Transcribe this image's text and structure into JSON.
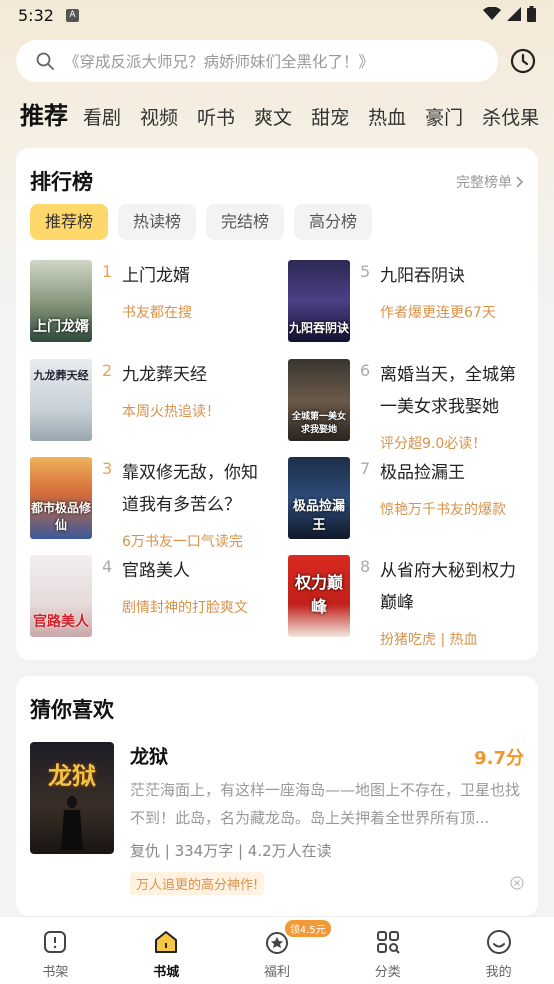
{
  "status": {
    "time": "5:32",
    "indicator": "A"
  },
  "search": {
    "placeholder": "《穿成反派大师兄？病娇师妹们全黑化了！》"
  },
  "tabs": [
    "推荐",
    "看剧",
    "视频",
    "听书",
    "爽文",
    "甜宠",
    "热血",
    "豪门",
    "杀伐果"
  ],
  "ranking": {
    "title": "排行榜",
    "full_list": "完整榜单",
    "chips": [
      "推荐榜",
      "热读榜",
      "完结榜",
      "高分榜"
    ],
    "items": [
      {
        "num": "1",
        "title": "上门龙婿",
        "sub": "书友都在搜",
        "cover_text": "上门龙婿",
        "cover_bg": "linear-gradient(180deg,#cfd6c6 0%,#8b9a7f 50%,#2e4a3a 100%)"
      },
      {
        "num": "2",
        "title": "九龙葬天经",
        "sub": "本周火热追读！",
        "cover_text": "九龙葬天经",
        "cover_bg": "linear-gradient(180deg,#e8ecef 0%,#c9d2d8 60%,#9aa7b0 100%)"
      },
      {
        "num": "3",
        "title": "靠双修无敌，你知道我有多苦么？",
        "sub": "6万书友一口气读完",
        "cover_text": "都市极品修仙",
        "cover_bg": "linear-gradient(180deg,#f0b35a 0%,#d46a3a 45%,#3a5a9a 100%)"
      },
      {
        "num": "4",
        "title": "官路美人",
        "sub": "剧情封神的打脸爽文",
        "cover_text": "官路美人",
        "cover_bg": "linear-gradient(180deg,#f3eeee 0%,#e6dada 60%,#c9a8a8 100%)"
      },
      {
        "num": "5",
        "title": "九阳吞阴诀",
        "sub": "作者爆更连更67天",
        "cover_text": "九阳吞阴诀",
        "cover_bg": "linear-gradient(180deg,#2c2a55 0%,#4b3f86 50%,#141230 100%)"
      },
      {
        "num": "6",
        "title": "离婚当天，全城第一美女求我娶她",
        "sub": "评分超9.0必读！",
        "cover_text": "全城第一美女求我娶她",
        "cover_bg": "linear-gradient(180deg,#3a3530 0%,#6a5a48 50%,#2a2420 100%)"
      },
      {
        "num": "7",
        "title": "极品捡漏王",
        "sub": "惊艳万千书友的爆款",
        "cover_text": "极品捡漏王",
        "cover_bg": "linear-gradient(180deg,#1e2e48 0%,#2d4c7a 50%,#111a2a 100%)"
      },
      {
        "num": "8",
        "title": "从省府大秘到权力巅峰",
        "sub": "扮猪吃虎 | 热血",
        "cover_text": "权力巅峰",
        "cover_bg": "linear-gradient(180deg,#d92a20 0%,#c2201a 60%,#f1e9e0 100%)"
      }
    ]
  },
  "guess": {
    "title": "猜你喜欢",
    "book": {
      "title": "龙狱",
      "score": "9.7分",
      "cover_text": "龙狱",
      "desc": "茫茫海面上，有这样一座海岛——地图上不存在，卫星也找不到！此岛，名为藏龙岛。岛上关押着全世界所有顶...",
      "meta": "复仇 | 334万字 | 4.2万人在读",
      "tag": "万人追更的高分神作!"
    }
  },
  "nav": {
    "items": [
      {
        "label": "书架",
        "icon": "bookshelf-icon"
      },
      {
        "label": "书城",
        "icon": "bookstore-icon"
      },
      {
        "label": "福利",
        "icon": "welfare-icon",
        "badge": "领4.5元"
      },
      {
        "label": "分类",
        "icon": "category-icon"
      },
      {
        "label": "我的",
        "icon": "profile-icon"
      }
    ]
  },
  "colors": {
    "accent": "#ffd86b",
    "rank_top": "#e8a35a",
    "score": "#f0962c"
  }
}
